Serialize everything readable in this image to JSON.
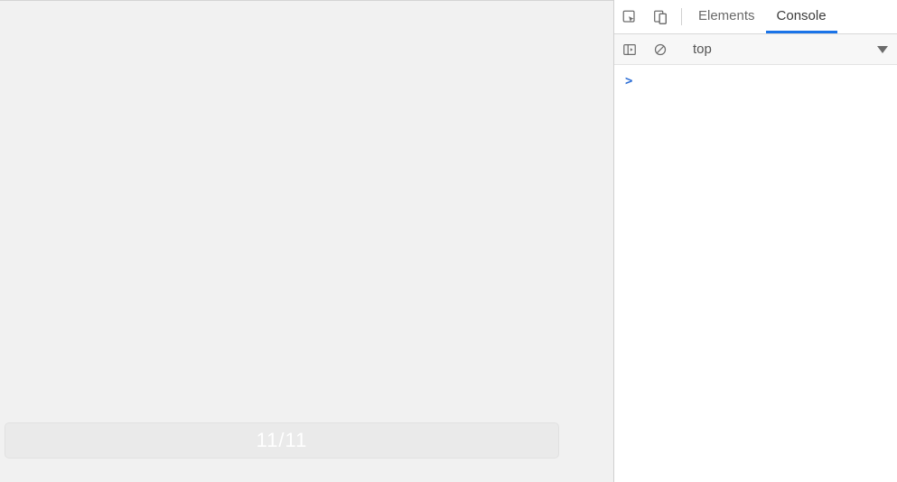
{
  "page": {
    "progress_label": "11/11"
  },
  "devtools": {
    "tabs": {
      "elements": "Elements",
      "console": "Console",
      "active": "console"
    },
    "context_selector": {
      "value": "top"
    },
    "console": {
      "prompt_symbol": ">",
      "input_value": ""
    }
  }
}
